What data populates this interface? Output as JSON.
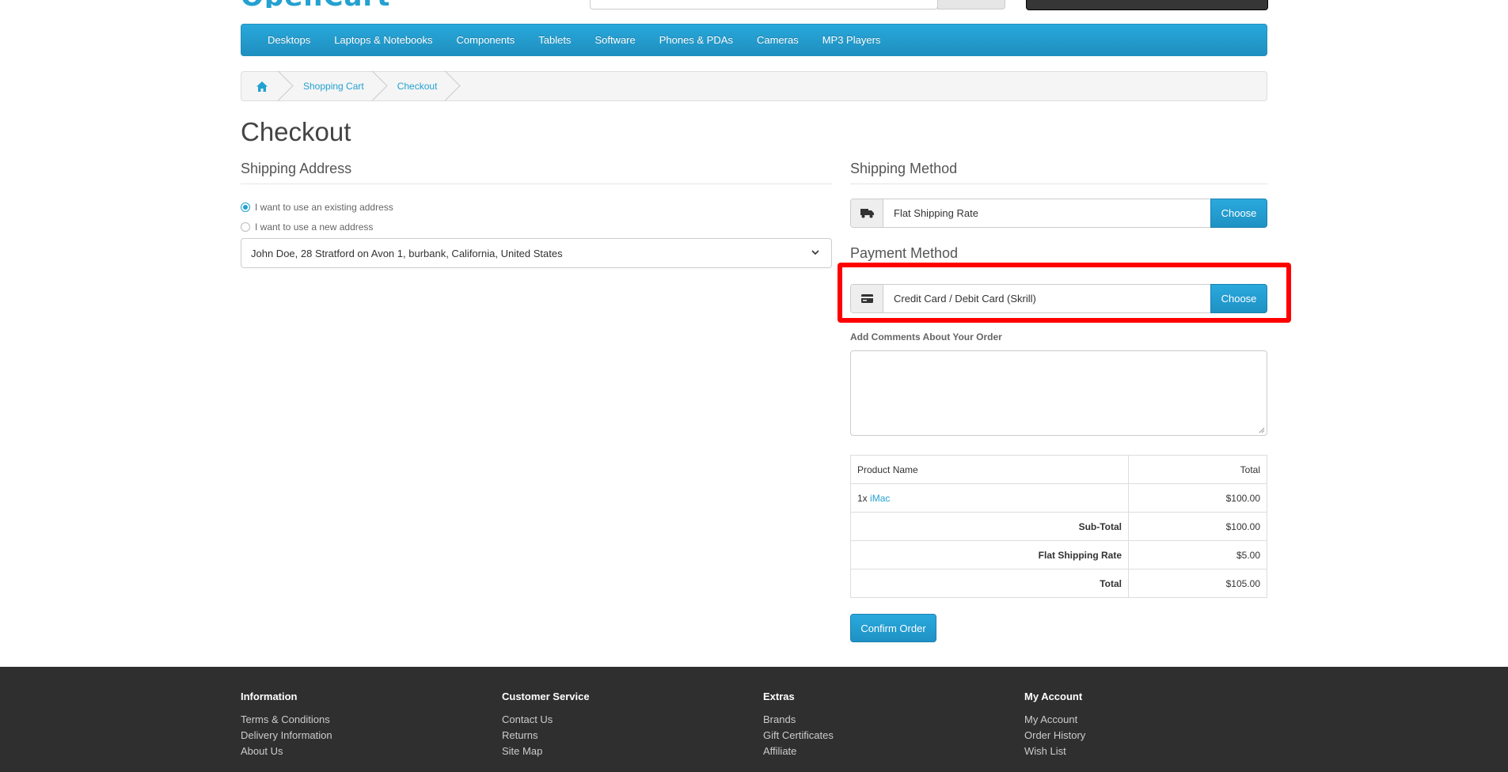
{
  "header": {
    "logo_text": "OpenCart"
  },
  "menu": {
    "items": [
      "Desktops",
      "Laptops & Notebooks",
      "Components",
      "Tablets",
      "Software",
      "Phones & PDAs",
      "Cameras",
      "MP3 Players"
    ]
  },
  "breadcrumb": {
    "items": [
      "Shopping Cart",
      "Checkout"
    ]
  },
  "page": {
    "title": "Checkout"
  },
  "shipping_address": {
    "legend": "Shipping Address",
    "option_existing": "I want to use an existing address",
    "option_new": "I want to use a new address",
    "selected_address": "John Doe, 28 Stratford on Avon 1, burbank, California, United States"
  },
  "shipping_method": {
    "legend": "Shipping Method",
    "value": "Flat Shipping Rate",
    "button": "Choose"
  },
  "payment_method": {
    "legend": "Payment Method",
    "value": "Credit Card / Debit Card (Skrill)",
    "button": "Choose"
  },
  "comments": {
    "label": "Add Comments About Your Order",
    "value": ""
  },
  "summary": {
    "header_product": "Product Name",
    "header_total": "Total",
    "item_qty": "1x",
    "item_name": "iMac",
    "item_total": "$100.00",
    "subtotal_label": "Sub-Total",
    "subtotal_value": "$100.00",
    "shipping_label": "Flat Shipping Rate",
    "shipping_value": "$5.00",
    "total_label": "Total",
    "total_value": "$105.00"
  },
  "confirm_button": "Confirm Order",
  "footer": {
    "information": {
      "title": "Information",
      "links": [
        "Terms & Conditions",
        "Delivery Information",
        "About Us"
      ]
    },
    "customer_service": {
      "title": "Customer Service",
      "links": [
        "Contact Us",
        "Returns",
        "Site Map"
      ]
    },
    "extras": {
      "title": "Extras",
      "links": [
        "Brands",
        "Gift Certificates",
        "Affiliate"
      ]
    },
    "my_account": {
      "title": "My Account",
      "links": [
        "My Account",
        "Order History",
        "Wish List"
      ]
    }
  },
  "colors": {
    "accent": "#23a1d1",
    "highlight": "#ff0000",
    "footer_bg": "#2f2f2f"
  }
}
